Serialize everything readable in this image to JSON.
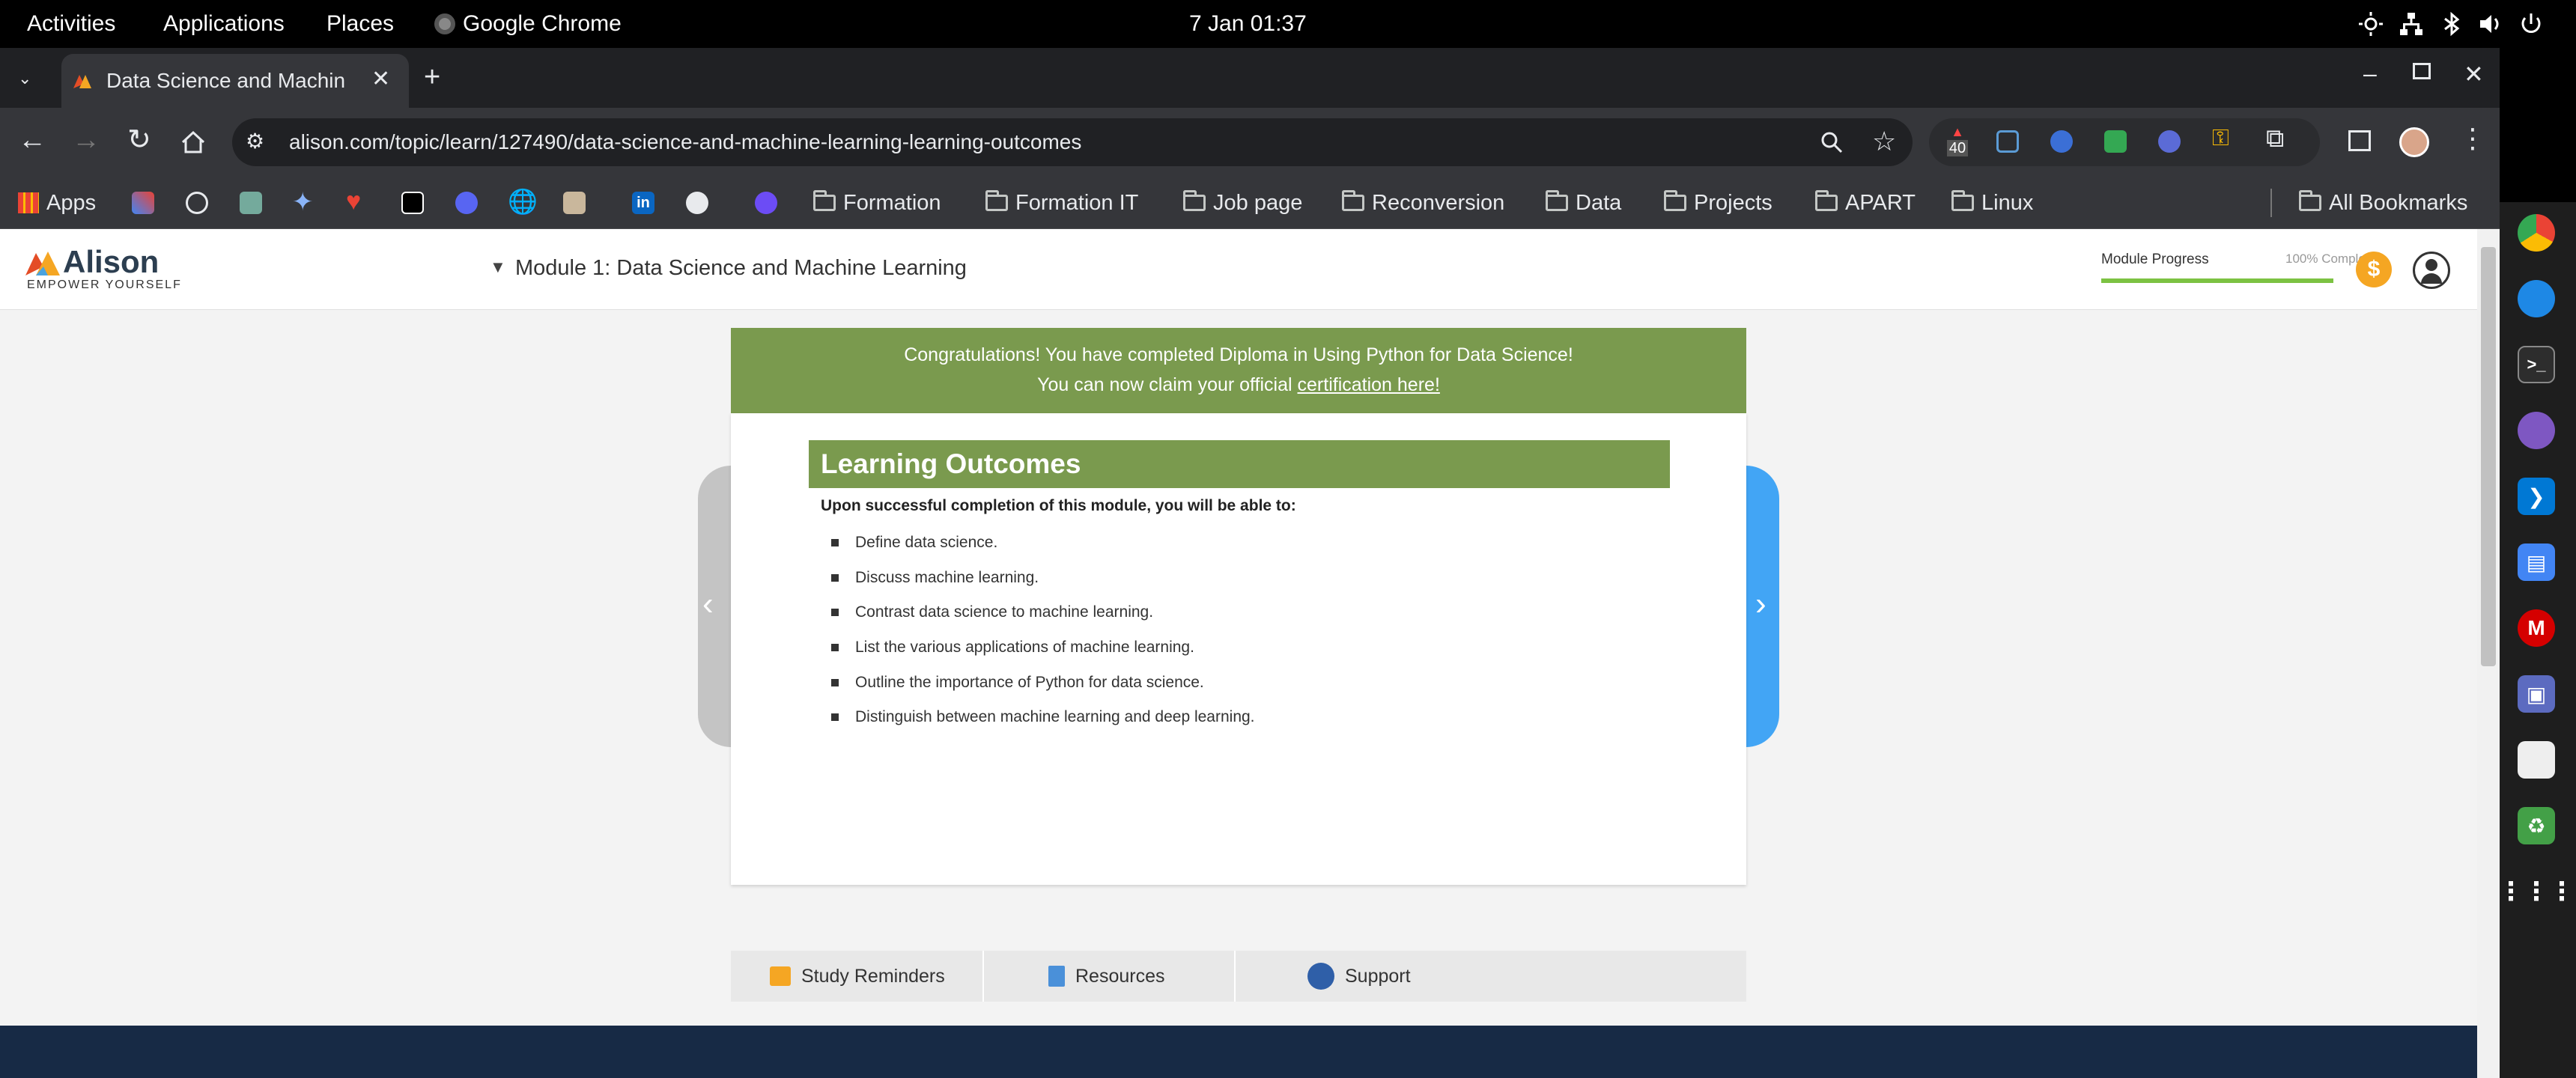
{
  "system_bar": {
    "activities": "Activities",
    "applications": "Applications",
    "places": "Places",
    "active_app": "Google Chrome",
    "clock": "7 Jan  01:37"
  },
  "browser": {
    "tab_title": "Data Science and Machin",
    "url": "alison.com/topic/learn/127490/data-science-and-machine-learning-learning-outcomes",
    "extension_badge": "40",
    "bookmarks": {
      "apps": "Apps",
      "folders": [
        "Formation",
        "Formation IT",
        "Job page",
        "Reconversion",
        "Data",
        "Projects",
        "APART",
        "Linux"
      ],
      "all_bookmarks": "All Bookmarks"
    }
  },
  "site": {
    "logo": "Alison",
    "tagline": "EMPOWER YOURSELF",
    "module_title": "Module 1: Data Science and Machine Learning",
    "progress_label": "Module Progress",
    "progress_text": "100% Complete",
    "progress_value": 1.0,
    "banner_line1": "Congratulations! You have completed Diploma in Using Python for Data Science!",
    "banner_line2_prefix": "You can now claim your official",
    "banner_link": "certification here!",
    "heading": "Learning Outcomes",
    "intro": "Upon successful completion of this module, you will be able to:",
    "outcomes": [
      "Define data science.",
      "Discuss machine learning.",
      "Contrast data science to machine learning.",
      "List the various applications of machine learning.",
      "Outline the importance of Python for data science.",
      "Distinguish between machine learning and deep learning."
    ],
    "bottom_bar": {
      "study_reminders": "Study Reminders",
      "resources": "Resources",
      "support": "Support"
    }
  },
  "colors": {
    "brand_green": "#7a9a4e",
    "next_arrow_blue": "#42a5f5",
    "footer_navy": "#172a45",
    "coin_orange": "#f5a623"
  }
}
